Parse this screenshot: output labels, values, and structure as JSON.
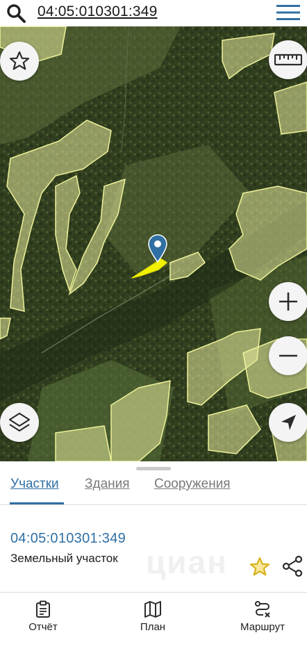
{
  "search": {
    "query": "04:05:010301:349"
  },
  "map_controls": {
    "favorite": "star-icon",
    "ruler": "ruler-icon",
    "zoom_in": "plus-icon",
    "zoom_out": "minus-icon",
    "layers": "layers-icon",
    "location": "navigation-arrow-icon"
  },
  "colors": {
    "accent": "#2f6fa3",
    "parcel_fill": "#e3e89a",
    "selected_parcel": "#f2f200",
    "marker": "#2f6fa3",
    "star": "#d8b21c"
  },
  "tabs": [
    {
      "label": "Участки",
      "active": true
    },
    {
      "label": "Здания",
      "active": false
    },
    {
      "label": "Сооружения",
      "active": false
    }
  ],
  "parcel": {
    "id": "04:05:010301:349",
    "type": "Земельный участок"
  },
  "watermark": "циан",
  "bottom_nav": [
    {
      "label": "Отчёт",
      "icon": "clipboard-icon"
    },
    {
      "label": "План",
      "icon": "map-icon"
    },
    {
      "label": "Маршрут",
      "icon": "route-icon"
    }
  ]
}
